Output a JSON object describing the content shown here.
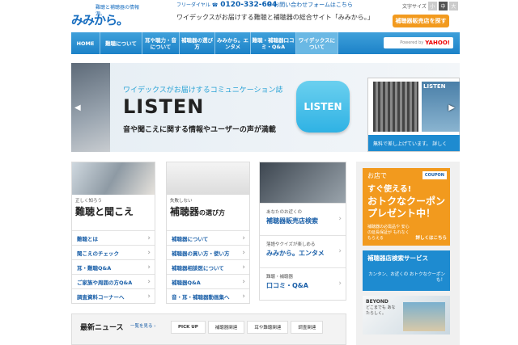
{
  "header": {
    "logo_text": "みみから。",
    "logo_sub": "難聴と補聴器の情報源。",
    "freedial_label": "フリーダイヤル",
    "freedial_number": "0120-332-604",
    "contact_link": "お問い合わせフォームはこちら",
    "tagline": "ワイデックスがお届けする難聴と補聴器の総合サイト「みみから。」",
    "font_size_label": "文字サイズ",
    "font_sizes": [
      "小",
      "中",
      "大"
    ],
    "find_store_button": "補聴器販売店を探す"
  },
  "nav": {
    "items": [
      "HOME",
      "難聴について",
      "耳や聴力・音について",
      "補聴器の選び方",
      "みみから。エンタメ",
      "難聴・補聴器口コミ・Q&A",
      "ワイデックスについて"
    ],
    "search_powered": "Powered by",
    "search_brand": "YAHOO!"
  },
  "hero": {
    "subtitle": "ワイデックスがお届けするコミュニケーション誌",
    "title": "LISTEN",
    "description": "音や聞こえに関する情報やユーザーの声が満載",
    "badge": "LISTEN",
    "thumb_label": "LISTEN",
    "free_text": "無料で差し上げています。 詳しく"
  },
  "col1": {
    "small": "正しく知ろう",
    "big": "難聴と聞こえ",
    "items": [
      "難聴とは",
      "聞こえのチェック",
      "耳・難聴Q&A",
      "ご家族や周囲の方Q&A",
      "調査資料コーナーへ"
    ]
  },
  "col2": {
    "small": "失敗しない",
    "big": "補聴器",
    "big_suffix": "の選び方",
    "items": [
      "補聴器について",
      "補聴器の買い方・使い方",
      "補聴器相談医について",
      "補聴器Q&A",
      "音・耳・補聴器動画集へ"
    ]
  },
  "col3": {
    "boxes": [
      {
        "s": "あなたのお近くの",
        "b": "補聴器販売店検索"
      },
      {
        "s": "落語やクイズが楽しめる",
        "b": "みみから。エンタメ"
      },
      {
        "s": "難聴・補聴器",
        "b": "口コミ・Q&A"
      }
    ]
  },
  "news": {
    "title": "最新ニュース",
    "all_link": "一覧を見る ›",
    "tabs": [
      "PICK UP",
      "補聴器関連",
      "耳や難聴関連",
      "調査関連"
    ]
  },
  "side": {
    "coupon": {
      "tag": "COUPON",
      "l1": "お店で",
      "l2": "すぐ使える!",
      "l3": "おトクなクーポン プレゼント中！",
      "l4": "補聴器の必需品や 安心の延長保証が もれなくもらえる",
      "link": "詳しくはこちら"
    },
    "search_service": {
      "title": "補聴器店検索サービス",
      "sub": "カンタン、お近くの おトクなクーポンも！"
    },
    "beyond": {
      "title": "BEYOND",
      "sub": "どこまでも あなたらしく。"
    }
  }
}
